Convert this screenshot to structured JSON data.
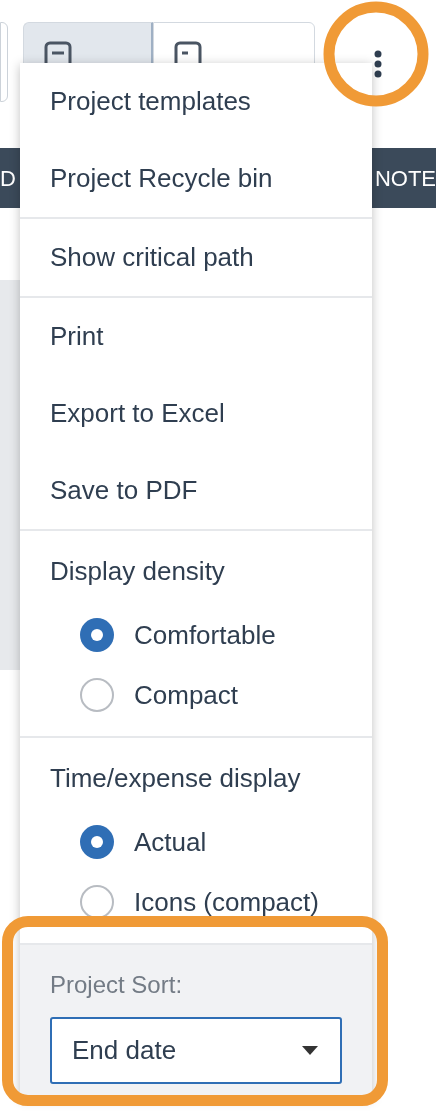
{
  "toolbar": {
    "view_buttons": [
      {
        "selected": true
      },
      {
        "selected": false
      }
    ]
  },
  "header_bar": {
    "columns": [
      "D",
      "NOTE"
    ]
  },
  "menu": {
    "sections": [
      {
        "kind": "actions",
        "items": [
          "Project templates",
          "Project Recycle bin"
        ]
      },
      {
        "kind": "actions",
        "items": [
          "Show critical path"
        ]
      },
      {
        "kind": "actions",
        "items": [
          "Print",
          "Export to Excel",
          "Save to PDF"
        ]
      },
      {
        "kind": "radio",
        "title": "Display density",
        "options": [
          {
            "label": "Comfortable",
            "selected": true
          },
          {
            "label": "Compact",
            "selected": false
          }
        ]
      },
      {
        "kind": "radio",
        "title": "Time/expense display",
        "options": [
          {
            "label": "Actual",
            "selected": true
          },
          {
            "label": "Icons (compact)",
            "selected": false
          }
        ]
      }
    ],
    "sort": {
      "label": "Project Sort:",
      "value": "End date"
    }
  }
}
